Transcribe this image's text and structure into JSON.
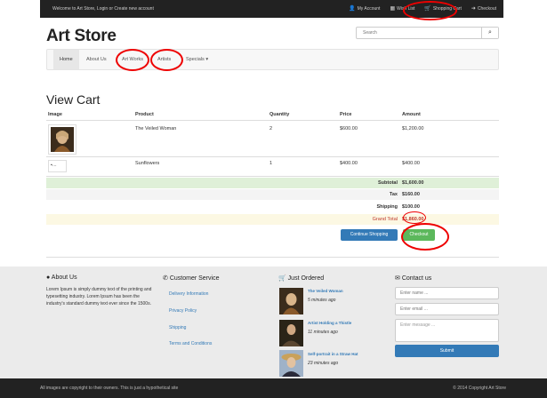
{
  "topbar": {
    "welcome": "Welcome to Art Store, Login or Create new account",
    "my_account": "My Account",
    "wish_list": "Wish List",
    "shopping_cart": "Shopping Cart",
    "checkout": "Checkout"
  },
  "brand": "Art Store",
  "search": {
    "placeholder": "Search"
  },
  "nav": {
    "home": "Home",
    "about": "About Us",
    "art_works": "Art Works",
    "artists": "Artists",
    "specials": "Specials"
  },
  "page_title": "View Cart",
  "cart": {
    "headers": [
      "Image",
      "Product",
      "Quantity",
      "Price",
      "Amount"
    ],
    "rows": [
      {
        "product": "The Veiled Woman",
        "quantity": "2",
        "price": "$600.00",
        "amount": "$1,200.00"
      },
      {
        "product": "Sunflowers",
        "quantity": "1",
        "price": "$400.00",
        "amount": "$400.00"
      }
    ],
    "subtotal_label": "Subtotal",
    "subtotal": "$1,600.00",
    "tax_label": "Tax",
    "tax": "$160.00",
    "shipping_label": "Shipping",
    "shipping": "$100.00",
    "grand_total_label": "Grand Total",
    "grand_total": "$1,860.00",
    "continue_label": "Continue Shopping",
    "checkout_label": "Checkout"
  },
  "footer": {
    "about_title": "About Us",
    "about_text": "Lorem Ipsum is simply dummy text of the printing and typesetting industry. Lorem Ipsum has been the industry's standard dummy text ever since the 1500s.",
    "service_title": "Customer Service",
    "service_links": [
      "Delivery Information",
      "Privacy Policy",
      "Shipping",
      "Terms and Conditions"
    ],
    "just_title": "Just Ordered",
    "just_items": [
      {
        "title": "The Veiled Woman",
        "ago": "5 minutes ago"
      },
      {
        "title": "Artist Holding a Thistle",
        "ago": "11 minutes ago"
      },
      {
        "title": "Self-portrait in a Straw Hat",
        "ago": "23 minutes ago"
      }
    ],
    "contact_title": "Contact us",
    "name_placeholder": "Enter name ...",
    "email_placeholder": "Enter email ...",
    "message_placeholder": "Enter message ...",
    "submit_label": "Submit"
  },
  "bottombar": {
    "left": "All images are copyright to their owners. This is just a hypothetical site",
    "right": "© 2014 Copyright Art Store"
  },
  "colors": {
    "primary": "#337ab7",
    "success": "#5cb85c",
    "annotation": "#e00000",
    "subtotal_bg": "#dff0d8",
    "grand_total_bg": "#fcf8e3"
  }
}
